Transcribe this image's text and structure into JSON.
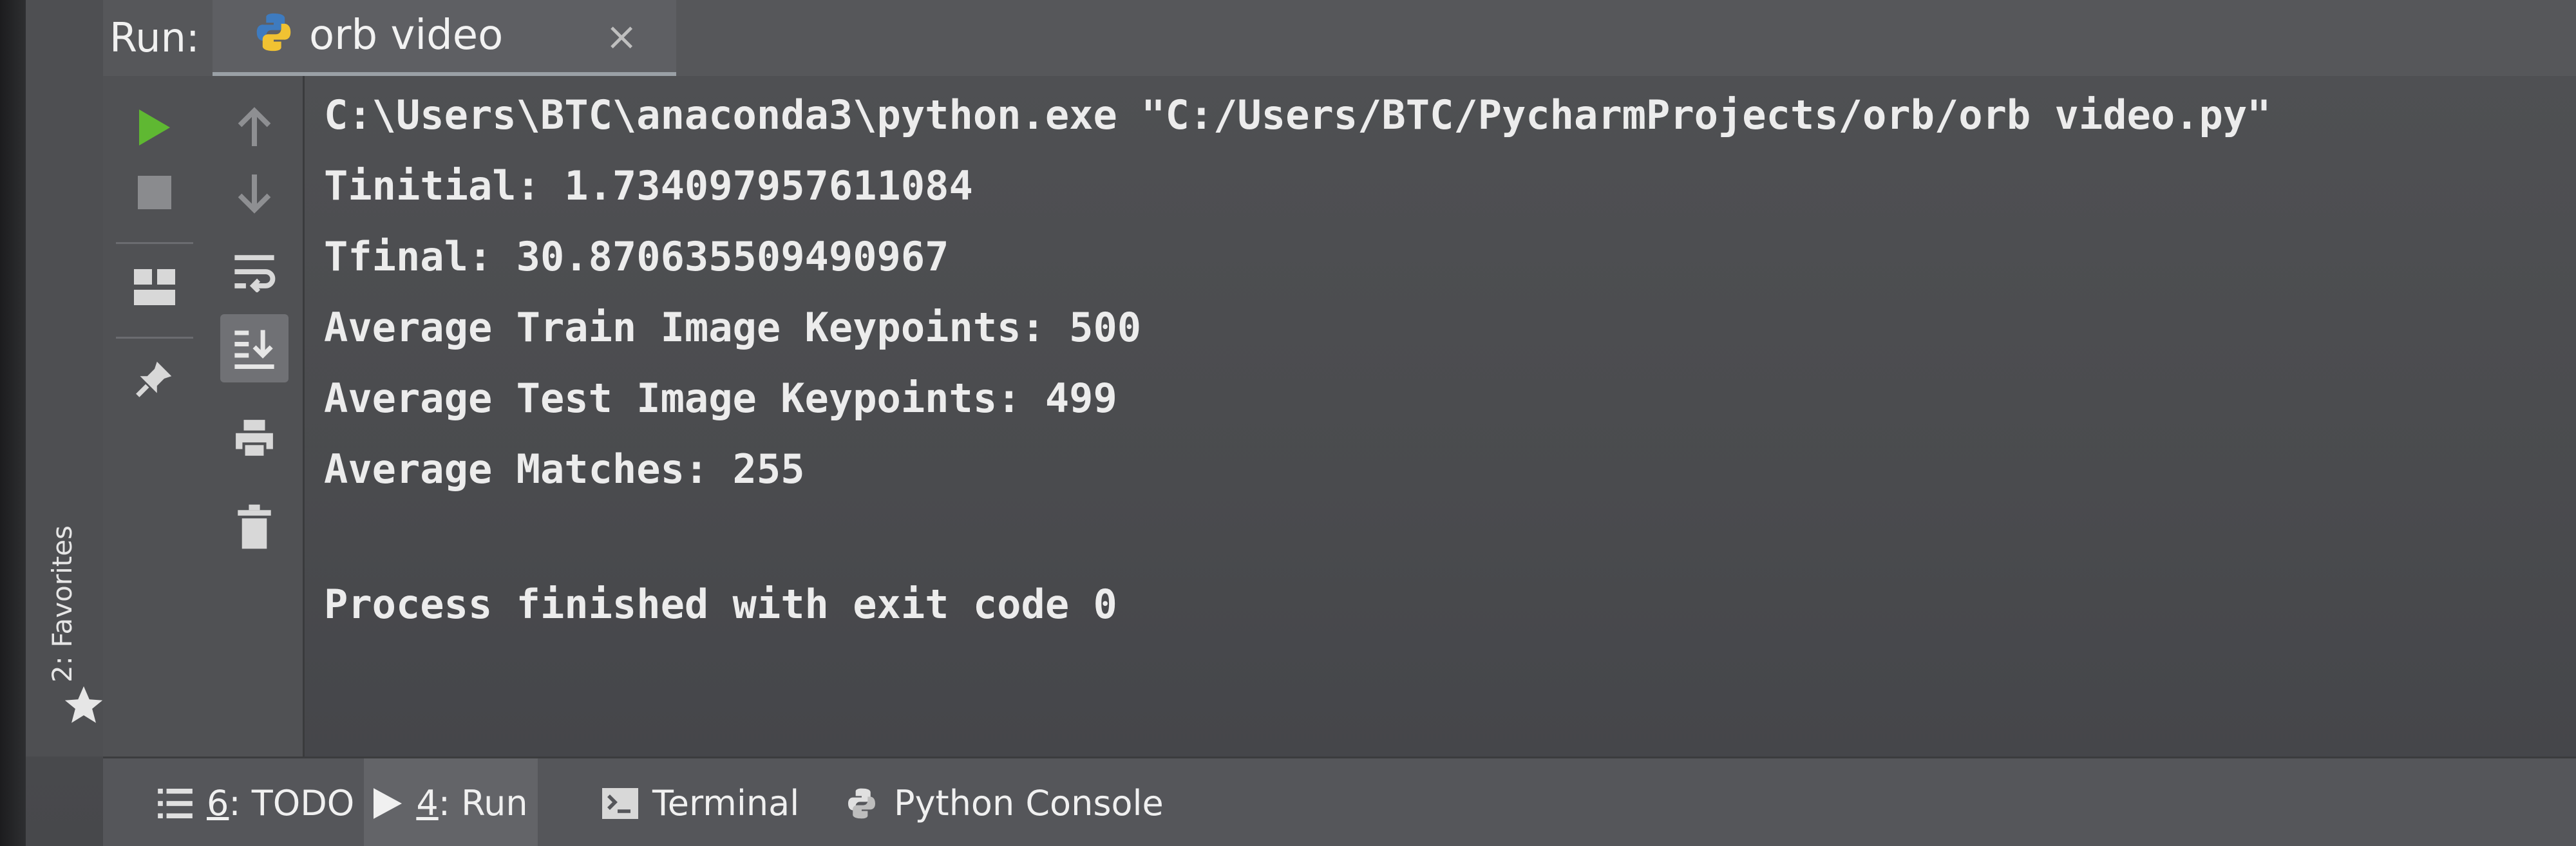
{
  "run_header": {
    "label": "Run:",
    "tab": {
      "title": "orb video",
      "close_glyph": "×",
      "icon": "python-icon"
    }
  },
  "left_toolbar": {
    "column_1": [
      "rerun-icon",
      "stop-icon",
      "layout-icon",
      "pin-icon"
    ],
    "column_2": [
      "up-arrow-icon",
      "down-arrow-icon",
      "soft-wrap-icon",
      "scroll-to-end-icon",
      "print-icon",
      "trash-icon"
    ]
  },
  "favorites": {
    "label": "2: Favorites",
    "icon": "star-icon"
  },
  "console": {
    "lines": [
      "C:\\Users\\BTC\\anaconda3\\python.exe \"C:/Users/BTC/PycharmProjects/orb/orb video.py\"",
      "Tinitial: 1.734097957611084",
      "Tfinal: 30.870635509490967",
      "Average Train Image Keypoints: 500",
      "Average Test Image Keypoints: 499",
      "Average Matches: 255",
      "",
      "Process finished with exit code 0"
    ]
  },
  "bottom_bar": {
    "tabs": [
      {
        "num": "6",
        "label": ": TODO",
        "icon": "list-icon",
        "active": false
      },
      {
        "num": "4",
        "label": ": Run",
        "icon": "play-icon",
        "active": true
      },
      {
        "num": "",
        "label": "Terminal",
        "icon": "terminal-icon",
        "active": false
      },
      {
        "num": "",
        "label": "Python Console",
        "icon": "python-icon",
        "active": false
      }
    ]
  },
  "colors": {
    "run_green": "#5fb832",
    "console_text": "#ececec",
    "background": "#4d4e51"
  }
}
